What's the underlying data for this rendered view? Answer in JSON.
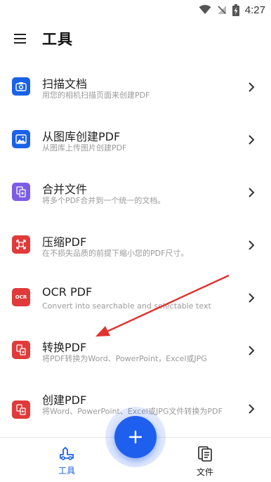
{
  "status_bar": {
    "time": "4:27"
  },
  "header": {
    "title": "工具"
  },
  "tools": [
    {
      "title": "扫描文档",
      "desc": "用您的相机扫描页面来创建PDF",
      "icon": "camera-icon",
      "color": "#1a62e6"
    },
    {
      "title": "从图库创建PDF",
      "desc": "从图库上传图片创建PDF",
      "icon": "image-icon",
      "color": "#1a62e6"
    },
    {
      "title": "合并文件",
      "desc": "将多个PDF合并到一个统一的文档。",
      "icon": "merge-icon",
      "color": "#7b5ce6"
    },
    {
      "title": "压缩PDF",
      "desc": "在不损失品质的前提下缩小您的PDF尺寸。",
      "icon": "compress-icon",
      "color": "#e03a3a"
    },
    {
      "title": "OCR PDF",
      "desc": "Convert into searchable and selectable text",
      "icon": "ocr-icon",
      "icon_text": "OCR",
      "color": "#e03a3a"
    },
    {
      "title": "转换PDF",
      "desc": "将PDF转换为Word、PowerPoint，Excel或JPG",
      "icon": "convert-icon",
      "color": "#e03a3a"
    },
    {
      "title": "创建PDF",
      "desc": "将Word、PowerPoint、Excel或JPG文件转换为PDF",
      "icon": "create-icon",
      "color": "#e03a3a"
    }
  ],
  "bottom_nav": {
    "tools_label": "工具",
    "files_label": "文件",
    "active": "工具",
    "active_color": "#1a62e6"
  },
  "fab": {
    "label": "+",
    "color": "#1f5fee"
  },
  "annotation": {
    "color": "#e0322e"
  }
}
